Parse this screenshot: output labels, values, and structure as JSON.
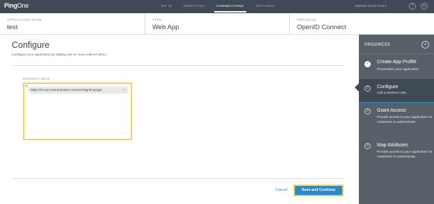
{
  "app": {
    "logo_main": "Ping",
    "logo_sub": "One"
  },
  "nav": {
    "items": [
      {
        "label": "MY ID"
      },
      {
        "label": "IDENTITIES"
      },
      {
        "label": "CONNECTIONS"
      },
      {
        "label": "SETTINGS"
      }
    ],
    "user": "MDEMO World Trust ▾"
  },
  "info": {
    "app_name_label": "APPLICATION NAME",
    "app_name": "test",
    "type_label": "TYPE",
    "type": "Web App",
    "protocol_label": "PROTOCOL",
    "protocol": "OpenID Connect"
  },
  "main": {
    "title": "Configure",
    "subtitle": "Configure your application by adding one or more redirect URLs.",
    "redirect_label": "REDIRECT URLS",
    "redirect_urls": [
      "https://lxcorp.onterpriseluto.com/oxcr/signin-pingid"
    ],
    "chip_remove": "×",
    "cancel_label": "Cancel",
    "save_label": "Save and Continue"
  },
  "progress": {
    "title": "PROGRESS",
    "close": "×",
    "steps": [
      {
        "num": "✓",
        "title": "Create App Profile",
        "desc": "Personalize your application"
      },
      {
        "num": "2",
        "title": "Configure",
        "desc": "Add a Redirect URL"
      },
      {
        "num": "3",
        "title": "Grant Access",
        "desc": "Provide access to your application for customers to authenticate."
      },
      {
        "num": "4",
        "title": "Map Attributes",
        "desc": "Provide access to your application for customers to authenticate."
      }
    ]
  },
  "colors": {
    "accent": "#2d8ac7",
    "highlight": "#f2d648",
    "sidebar": "#576069",
    "topbar": "#3f4a55"
  }
}
